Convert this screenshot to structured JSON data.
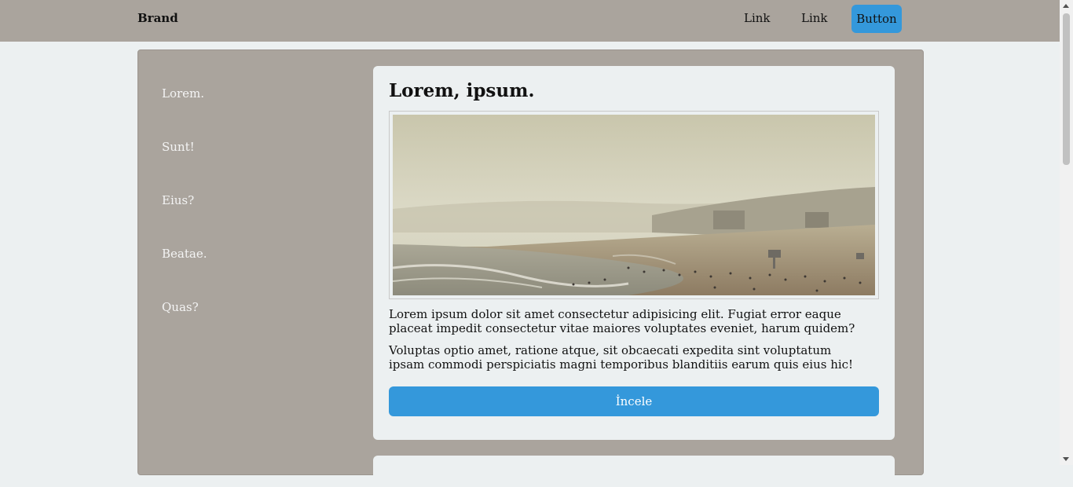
{
  "navbar": {
    "brand": "Brand",
    "links": [
      "Link",
      "Link"
    ],
    "button_label": "Button"
  },
  "sidebar": {
    "items": [
      {
        "label": "Lorem."
      },
      {
        "label": "Sunt!"
      },
      {
        "label": "Eius?"
      },
      {
        "label": "Beatae."
      },
      {
        "label": "Quas?"
      }
    ]
  },
  "card": {
    "title": "Lorem, ipsum.",
    "paragraphs": [
      "Lorem ipsum dolor sit amet consectetur adipisicing elit. Fugiat error eaque placeat impedit consectetur vitae maiores voluptates eveniet, harum quidem?",
      "Voluptas optio amet, ratione atque, sit obcaecati expedita sint voluptatum ipsam commodi perspiciatis magni temporibus blanditiis earum quis eius hic!"
    ],
    "button_label": "İncele"
  },
  "colors": {
    "navbar_bg": "#aaa49d",
    "page_bg": "#ecf0f1",
    "accent": "#3498db"
  }
}
